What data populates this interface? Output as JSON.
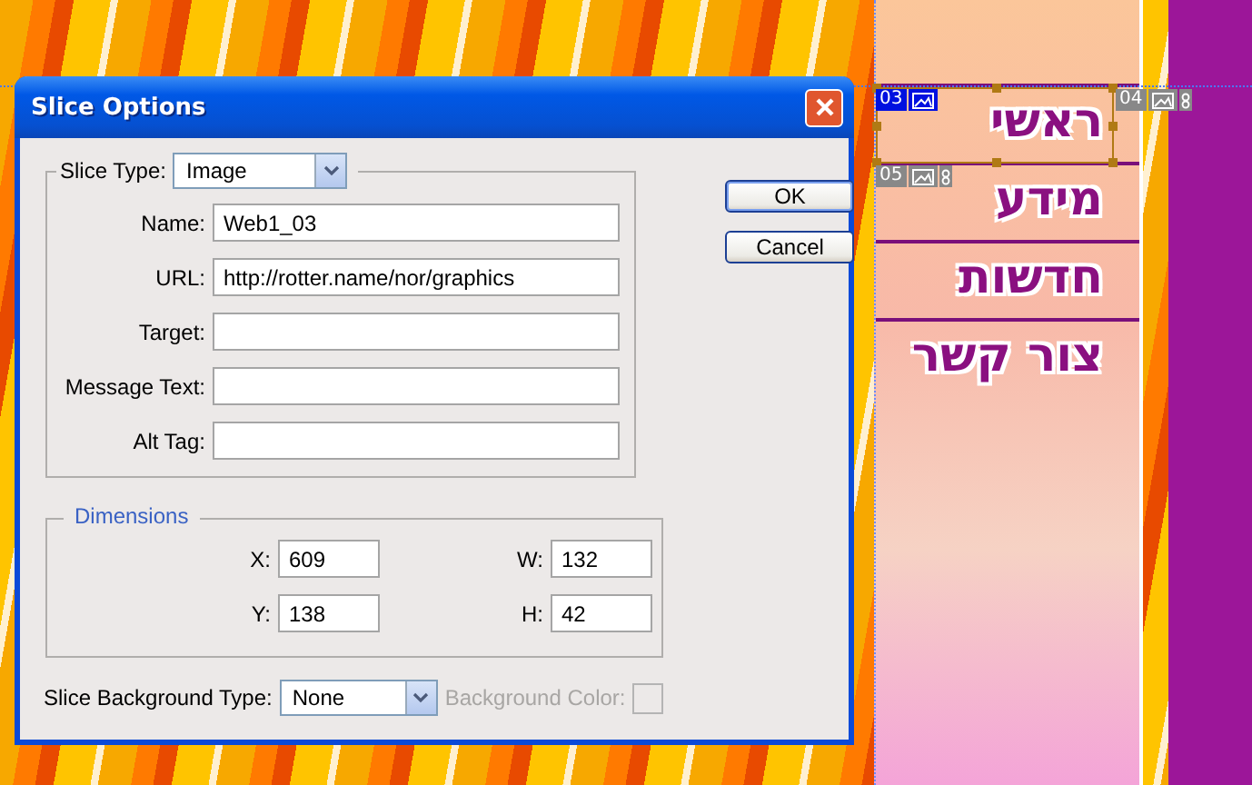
{
  "canvas": {
    "menu_items": [
      "ראשי",
      "מידע",
      "חדשות",
      "צור קשר"
    ],
    "slice_tags": [
      {
        "number": "03",
        "selected": true,
        "linked": false
      },
      {
        "number": "04",
        "selected": false,
        "linked": true
      },
      {
        "number": "05",
        "selected": false,
        "linked": true
      }
    ]
  },
  "dialog": {
    "title": "Slice Options",
    "slice_type": {
      "label": "Slice Type:",
      "value": "Image"
    },
    "fields": [
      {
        "label": "Name:",
        "value": "Web1_03"
      },
      {
        "label": "URL:",
        "value": "http://rotter.name/nor/graphics"
      },
      {
        "label": "Target:"
      },
      {
        "label": "Message Text:"
      },
      {
        "label": "Alt Tag:"
      }
    ],
    "buttons": [
      "OK",
      "Cancel"
    ],
    "dimensions": {
      "title": "Dimensions",
      "fields": [
        {
          "label": "X:",
          "value": "609"
        },
        {
          "label": "W:",
          "value": "132"
        },
        {
          "label": "Y:",
          "value": "138"
        },
        {
          "label": "H:",
          "value": "42"
        }
      ]
    },
    "background_type": {
      "label": "Slice Background Type:",
      "value": "None"
    },
    "background_color": {
      "label": "Background Color:",
      "disabled": true
    }
  }
}
